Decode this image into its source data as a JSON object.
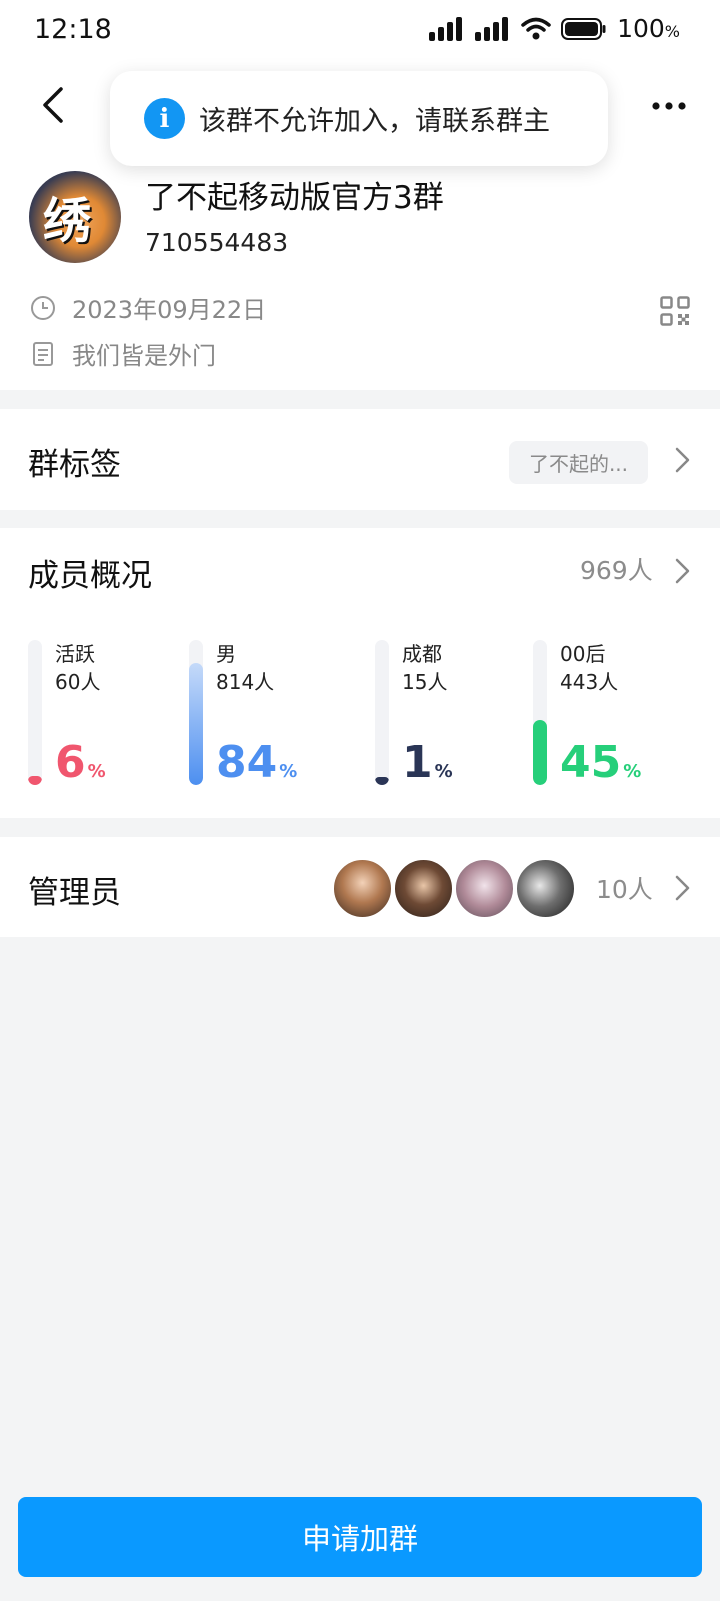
{
  "status_bar": {
    "time": "12:18",
    "battery": "100",
    "battery_unit": "%"
  },
  "toast": {
    "icon": "info-icon",
    "text": "该群不允许加入，请联系群主"
  },
  "group": {
    "name": "了不起移动版官方3群",
    "id": "710554483",
    "created_date": "2023年09月22日",
    "description": "我们皆是外门"
  },
  "tags_section": {
    "title": "群标签",
    "chip": "了不起的..."
  },
  "members_section": {
    "title": "成员概况",
    "count": "969人",
    "stats": [
      {
        "label": "活跃",
        "count": "60人",
        "pct": "6",
        "unit": "%",
        "fill": 0.06,
        "color": "#f0566e"
      },
      {
        "label": "男",
        "count": "814人",
        "pct": "84",
        "unit": "%",
        "fill": 0.84,
        "color": "#4d8ff0"
      },
      {
        "label": "成都",
        "count": "15人",
        "pct": "1",
        "unit": "%",
        "fill": 0.01,
        "color": "#2a3556"
      },
      {
        "label": "00后",
        "count": "443人",
        "pct": "45",
        "unit": "%",
        "fill": 0.45,
        "color": "#26cf7a"
      }
    ]
  },
  "admins_section": {
    "title": "管理员",
    "count": "10人"
  },
  "join_button": {
    "label": "申请加群"
  },
  "colors": {
    "accent": "#0a99ff",
    "toast_icon": "#1296f3"
  }
}
